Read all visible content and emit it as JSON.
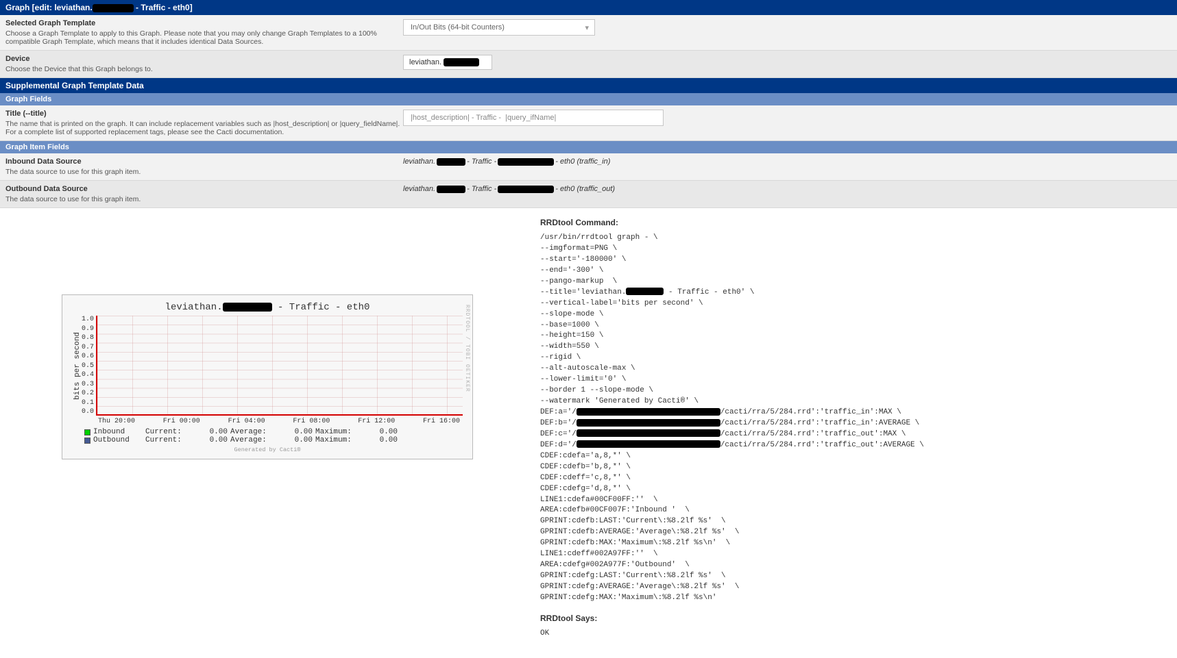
{
  "header": {
    "prefix": "Graph [edit: leviathan.",
    "suffix": " - Traffic - eth0]"
  },
  "template": {
    "label": "Selected Graph Template",
    "desc": "Choose a Graph Template to apply to this Graph. Please note that you may only change Graph Templates to a 100% compatible Graph Template, which means that it includes identical Data Sources.",
    "value": "In/Out Bits (64-bit Counters)"
  },
  "device": {
    "label": "Device",
    "desc": "Choose the Device that this Graph belongs to.",
    "prefix": "leviathan."
  },
  "supp_header": "Supplemental Graph Template Data",
  "graph_fields_header": "Graph Fields",
  "title_field": {
    "label": "Title (--title)",
    "desc": "The name that is printed on the graph. It can include replacement variables such as |host_description| or |query_fieldName|. For a complete list of supported replacement tags, please see the Cacti documentation.",
    "value": "|host_description| - Traffic -  |query_ifName|"
  },
  "item_fields_header": "Graph Item Fields",
  "inbound": {
    "label": "Inbound Data Source",
    "desc": "The data source to use for this graph item.",
    "pre": "leviathan.",
    "mid": " - Traffic - ",
    "suf": " - eth0 (traffic_in)"
  },
  "outbound": {
    "label": "Outbound Data Source",
    "desc": "The data source to use for this graph item.",
    "pre": "leviathan.",
    "mid": " - Traffic - ",
    "suf": " - eth0 (traffic_out)"
  },
  "rrd": {
    "title": "RRDtool Command:",
    "lines_a": [
      "/usr/bin/rrdtool graph - \\",
      "--imgformat=PNG \\",
      "--start='-180000' \\",
      "--end='-300' \\",
      "--pango-markup  \\"
    ],
    "title_pre": "--title='leviathan.",
    "title_suf": " - Traffic - eth0' \\",
    "lines_b": [
      "--vertical-label='bits per second' \\",
      "--slope-mode \\",
      "--base=1000 \\",
      "--height=150 \\",
      "--width=550 \\",
      "--rigid \\",
      "--alt-autoscale-max \\",
      "--lower-limit='0' \\",
      "--border 1 --slope-mode \\",
      "--watermark 'Generated by Cacti®' \\"
    ],
    "def_a_pre": "DEF:a='/",
    "def_a_suf": "/cacti/rra/5/284.rrd':'traffic_in':MAX \\",
    "def_b_pre": "DEF:b='/",
    "def_b_suf": "/cacti/rra/5/284.rrd':'traffic_in':AVERAGE \\",
    "def_c_pre": "DEF:c='/",
    "def_c_suf": "/cacti/rra/5/284.rrd':'traffic_out':MAX \\",
    "def_d_pre": "DEF:d='/",
    "def_d_suf": "/cacti/rra/5/284.rrd':'traffic_out':AVERAGE \\",
    "lines_c": [
      "CDEF:cdefa='a,8,*' \\",
      "CDEF:cdefb='b,8,*' \\",
      "CDEF:cdeff='c,8,*' \\",
      "CDEF:cdefg='d,8,*' \\",
      "LINE1:cdefa#00CF00FF:''  \\",
      "AREA:cdefb#00CF007F:'Inbound '  \\",
      "GPRINT:cdefb:LAST:'Current\\:%8.2lf %s'  \\",
      "GPRINT:cdefb:AVERAGE:'Average\\:%8.2lf %s'  \\",
      "GPRINT:cdefb:MAX:'Maximum\\:%8.2lf %s\\n'  \\",
      "LINE1:cdeff#002A97FF:''  \\",
      "AREA:cdefg#002A977F:'Outbound'  \\",
      "GPRINT:cdefg:LAST:'Current\\:%8.2lf %s'  \\",
      "GPRINT:cdefg:AVERAGE:'Average\\:%8.2lf %s'  \\",
      "GPRINT:cdefg:MAX:'Maximum\\:%8.2lf %s\\n' "
    ],
    "says_label": "RRDtool Says:",
    "says_value": "OK"
  },
  "chart_data": {
    "type": "line",
    "title_pre": "leviathan.",
    "title_suf": " - Traffic - eth0",
    "ylabel": "bits per second",
    "ylim": [
      0.0,
      1.0
    ],
    "yticks": [
      "1.0",
      "0.9",
      "0.8",
      "0.7",
      "0.6",
      "0.5",
      "0.4",
      "0.3",
      "0.2",
      "0.1",
      "0.0"
    ],
    "xticks": [
      "Thu 20:00",
      "Fri 00:00",
      "Fri 04:00",
      "Fri 08:00",
      "Fri 12:00",
      "Fri 16:00"
    ],
    "series": [
      {
        "name": "Inbound",
        "color": "#00CF00",
        "current": 0.0,
        "average": 0.0,
        "maximum": 0.0
      },
      {
        "name": "Outbound",
        "color": "#445993",
        "current": 0.0,
        "average": 0.0,
        "maximum": 0.0
      }
    ],
    "legend_headers": {
      "current": "Current:",
      "average": "Average:",
      "maximum": "Maximum:"
    },
    "footer": "Generated by Cacti®",
    "side": "RRDTOOL / TOBI OETIKER"
  }
}
